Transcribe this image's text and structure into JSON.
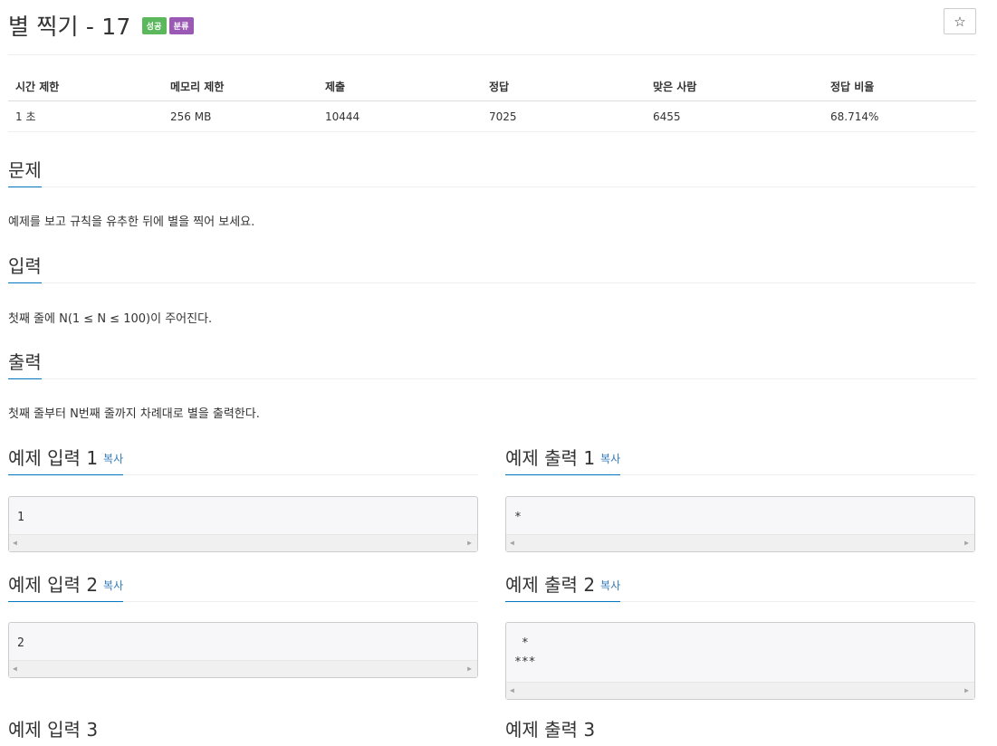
{
  "problem": {
    "title": "별 찍기 - 17",
    "badges": [
      "성공",
      "분류"
    ],
    "star": "☆"
  },
  "info_table": {
    "headers": [
      "시간 제한",
      "메모리 제한",
      "제출",
      "정답",
      "맞은 사람",
      "정답 비율"
    ],
    "values": [
      "1 초",
      "256 MB",
      "10444",
      "7025",
      "6455",
      "68.714%"
    ]
  },
  "sections": {
    "problem": {
      "title": "문제",
      "text": "예제를 보고 규칙을 유추한 뒤에 별을 찍어 보세요."
    },
    "input": {
      "title": "입력",
      "text": "첫째 줄에 N(1 ≤ N ≤ 100)이 주어진다."
    },
    "output": {
      "title": "출력",
      "text": "첫째 줄부터 N번째 줄까지 차례대로 별을 출력한다."
    }
  },
  "samples": {
    "copy_label": "복사",
    "in1": {
      "title": "예제 입력 1",
      "content": "1"
    },
    "out1": {
      "title": "예제 출력 1",
      "content": "*"
    },
    "in2": {
      "title": "예제 입력 2",
      "content": "2"
    },
    "out2": {
      "title": "예제 출력 2",
      "content": " *\n***"
    },
    "in3": {
      "title": "예제 입력 3"
    },
    "out3": {
      "title": "예제 출력 3"
    }
  }
}
